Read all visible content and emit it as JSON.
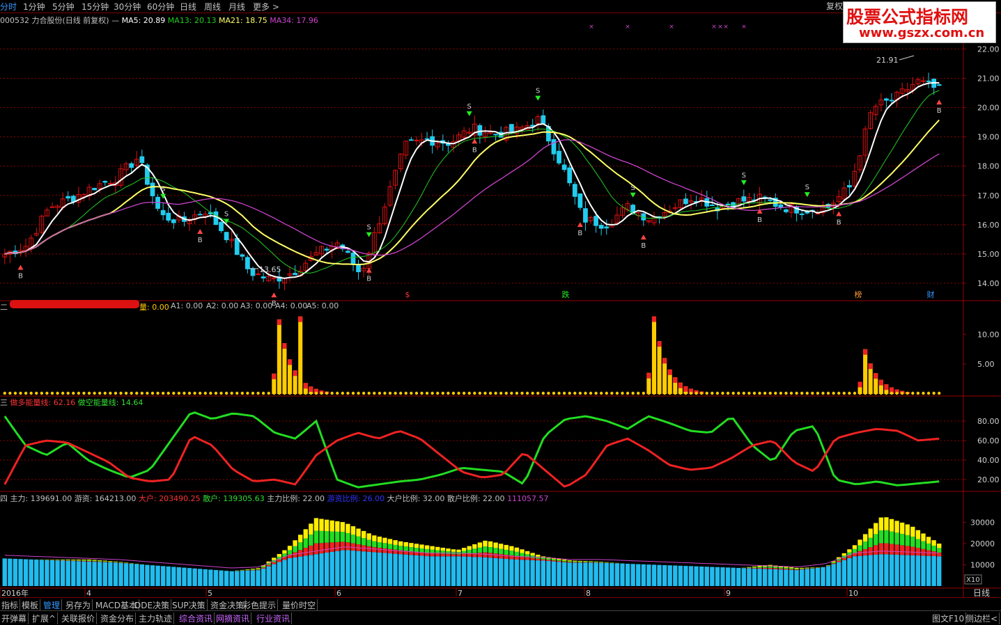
{
  "top_tabs": [
    "分时",
    "1分钟",
    "5分钟",
    "15分钟",
    "30分钟",
    "60分钟",
    "日线",
    "周线",
    "月线",
    "更多 >"
  ],
  "fq_button": "复权",
  "watermark": {
    "cn": "股票公式指标网",
    "url": "www.gszx.com.cn"
  },
  "panel1": {
    "title": "000532 力合股份(日线 前复权) —",
    "ma": [
      {
        "label": "MA5: 20.89",
        "color": "#ffffff"
      },
      {
        "label": "MA13: 20.13",
        "color": "#22cc22"
      },
      {
        "label": "MA21: 18.75",
        "color": "#ffff66"
      },
      {
        "label": "MA34: 17.96",
        "color": "#cc44cc"
      }
    ],
    "y_ticks": [
      "22.00",
      "21.00",
      "20.00",
      "19.00",
      "18.00",
      "17.00",
      "16.00",
      "15.00",
      "14.00"
    ],
    "high_label": "21.91",
    "low_label": "13.65",
    "events": [
      "$",
      "跌",
      "榜",
      "财"
    ]
  },
  "panel2": {
    "title_prefix": "二",
    "labels": [
      "量: 0.00",
      "A1: 0.00",
      "A2: 0.00",
      "A3: 0.00",
      "A4: 0.00",
      "A5: 0.00"
    ],
    "y_ticks": [
      "10.00",
      "5.00"
    ]
  },
  "panel3": {
    "title_prefix": "三",
    "bull_label": "做多能量线: 62.16",
    "bear_label": "做空能量线: 14.64",
    "y_ticks": [
      "80.00",
      "60.00",
      "40.00",
      "20.00"
    ]
  },
  "panel4": {
    "title_prefix": "四",
    "labels": [
      {
        "text": "主力: 139691.00",
        "color": "#c0c0c0"
      },
      {
        "text": "游资: 164213.00",
        "color": "#c0c0c0"
      },
      {
        "text": "大户: 203490.25",
        "color": "#ff3333"
      },
      {
        "text": "散户: 139305.63",
        "color": "#33dd33"
      },
      {
        "text": "主力比例: 22.00",
        "color": "#c0c0c0"
      },
      {
        "text": "游资比例: 26.00",
        "color": "#3333ff"
      },
      {
        "text": "大户比例: 32.00",
        "color": "#c0c0c0"
      },
      {
        "text": "散户比例: 22.00",
        "color": "#c0c0c0"
      },
      {
        "text": "111057.57",
        "color": "#cc44cc"
      }
    ],
    "y_ticks": [
      "30000",
      "20000",
      "10000"
    ],
    "scale": "X10"
  },
  "x_axis": {
    "labels": [
      "2016年",
      "4",
      "5",
      "6",
      "7",
      "8",
      "9",
      "10"
    ],
    "period": "日线"
  },
  "toolbar": [
    "指标",
    "模板",
    "管理",
    "另存为",
    "MACD基本",
    "DDE决策",
    "SUP决策",
    "资金决策",
    "彩色提示",
    "量价时空"
  ],
  "bottom_bar": [
    "开弹幕",
    "扩展^",
    "关联报价",
    "资金分布",
    "主力轨迹",
    "综合资讯",
    "网摘资讯",
    "行业资讯"
  ],
  "bottom_right": [
    "图文F10",
    "侧边栏<"
  ],
  "signals": {
    "buy": "B",
    "sell": "S"
  },
  "colors": {
    "up": "#dd1111",
    "down": "#22ccee",
    "grid": "#8b0000",
    "ma5": "#ffffff",
    "ma13": "#22cc22",
    "ma21": "#ffff66",
    "ma34": "#cc44cc"
  },
  "chart_data": [
    {
      "type": "candlestick",
      "title": "000532 力合股份(日线 前复权)",
      "ylim": [
        13.5,
        22.2
      ],
      "x_labels": [
        "2016年",
        "4",
        "5",
        "6",
        "7",
        "8",
        "9",
        "10"
      ],
      "close_path": [
        15.0,
        15.3,
        16.6,
        16.9,
        17.3,
        17.6,
        18.3,
        16.3,
        16.1,
        16.5,
        15.6,
        14.4,
        14.1,
        14.4,
        15.0,
        15.4,
        14.3,
        16.5,
        18.7,
        18.9,
        18.8,
        19.3,
        19.1,
        19.2,
        19.6,
        18.1,
        16.2,
        16.0,
        16.6,
        16.2,
        16.6,
        17.0,
        16.6,
        16.8,
        16.9,
        16.6,
        16.5,
        16.6,
        17.3,
        20.0,
        20.3,
        20.9,
        20.6
      ],
      "buy_signals": 10,
      "sell_signals": 8
    },
    {
      "type": "bar",
      "name": "量",
      "ylim": [
        0,
        14
      ],
      "series": [
        {
          "name": "量",
          "peaks": [
            12.5,
            13.0,
            7.5
          ]
        }
      ]
    },
    {
      "type": "line",
      "ylim": [
        10,
        95
      ],
      "series": [
        {
          "name": "做多能量线",
          "last": 62.16
        },
        {
          "name": "做空能量线",
          "last": 14.64
        }
      ]
    },
    {
      "type": "bar",
      "ylim": [
        0,
        40000
      ],
      "series": [
        {
          "name": "主力",
          "last": 139691.0
        },
        {
          "name": "游资",
          "last": 164213.0
        },
        {
          "name": "大户",
          "last": 203490.25
        },
        {
          "name": "散户",
          "last": 139305.63
        }
      ]
    }
  ]
}
